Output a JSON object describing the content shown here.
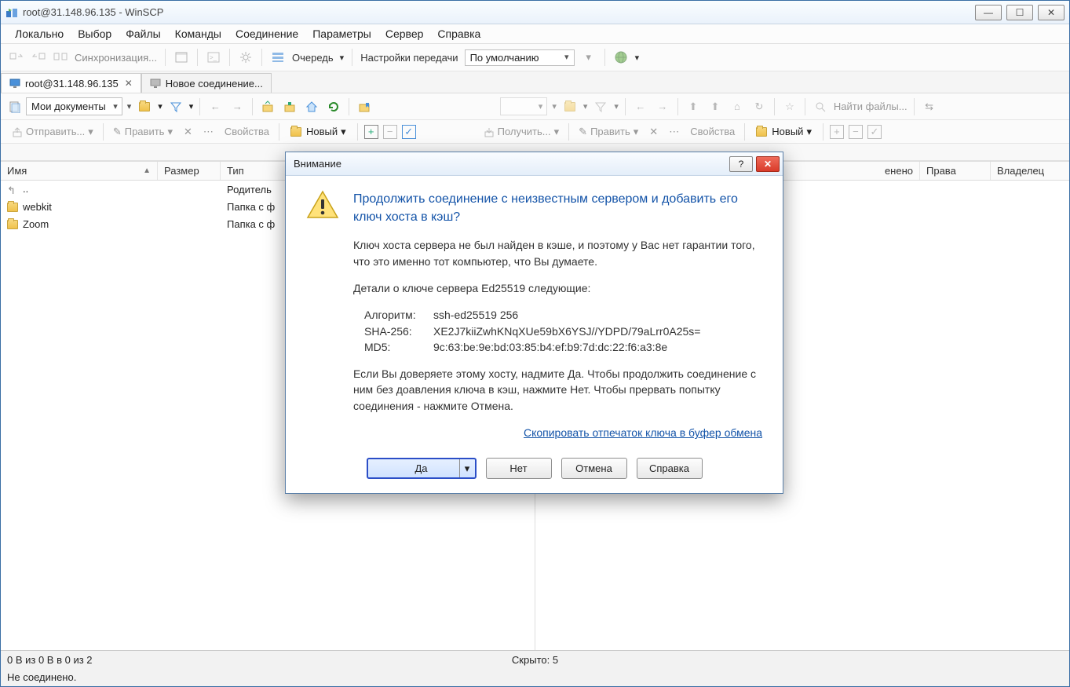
{
  "app": {
    "title": "root@31.148.96.135 - WinSCP"
  },
  "menu": [
    "Локально",
    "Выбор",
    "Файлы",
    "Команды",
    "Соединение",
    "Параметры",
    "Сервер",
    "Справка"
  ],
  "toolbar": {
    "sync": "Синхронизация...",
    "queue": "Очередь",
    "transfer_label": "Настройки передачи",
    "transfer_preset": "По умолчанию"
  },
  "tabs": [
    {
      "label": "root@31.148.96.135",
      "closable": true
    },
    {
      "label": "Новое соединение..."
    }
  ],
  "nav": {
    "left_location": "Мои документы",
    "find_files": "Найти файлы..."
  },
  "actions": {
    "upload": "Отправить...",
    "edit": "Править",
    "props": "Свойства",
    "new": "Новый",
    "download": "Получить...",
    "edit_r": "Править",
    "props_r": "Свойства",
    "new_r": "Новый"
  },
  "columns_left": [
    "Имя",
    "Размер",
    "Тип"
  ],
  "columns_right_tail": [
    "Права",
    "Владелец"
  ],
  "columns_right_partial": "енено",
  "files": [
    {
      "name": "..",
      "type": "Родитель",
      "up": true
    },
    {
      "name": "webkit",
      "type": "Папка с ф"
    },
    {
      "name": "Zoom",
      "type": "Папка с ф"
    }
  ],
  "status": {
    "left_footer": "0 B из 0 B в 0 из 2",
    "hidden": "Скрыто: 5",
    "connection": "Не соединено."
  },
  "dialog": {
    "title": "Внимание",
    "heading": "Продолжить соединение с неизвестным сервером и добавить его ключ хоста в кэш?",
    "para1": "Ключ хоста сервера не был найден в кэше, и поэтому у Вас нет гарантии того, что это именно тот компьютер, что Вы думаете.",
    "para2": "Детали о ключе сервера Ed25519 следующие:",
    "algo_label": "Алгоритм:",
    "algo_val": "ssh-ed25519 256",
    "sha_label": "SHA-256:",
    "sha_val": "XE2J7kiiZwhKNqXUe59bX6YSJ//YDPD/79aLrr0A25s=",
    "md5_label": "MD5:",
    "md5_val": "9c:63:be:9e:bd:03:85:b4:ef:b9:7d:dc:22:f6:a3:8e",
    "para3": "Если Вы доверяете этому хосту, надмите Да. Чтобы продолжить соединение с ним без доавления ключа в кэш, нажмите Нет. Чтобы прервать попытку соединения - нажмите Отмена.",
    "copy_link": "Скопировать отпечаток ключа в буфер обмена",
    "yes": "Да",
    "no": "Нет",
    "cancel": "Отмена",
    "help": "Справка"
  }
}
